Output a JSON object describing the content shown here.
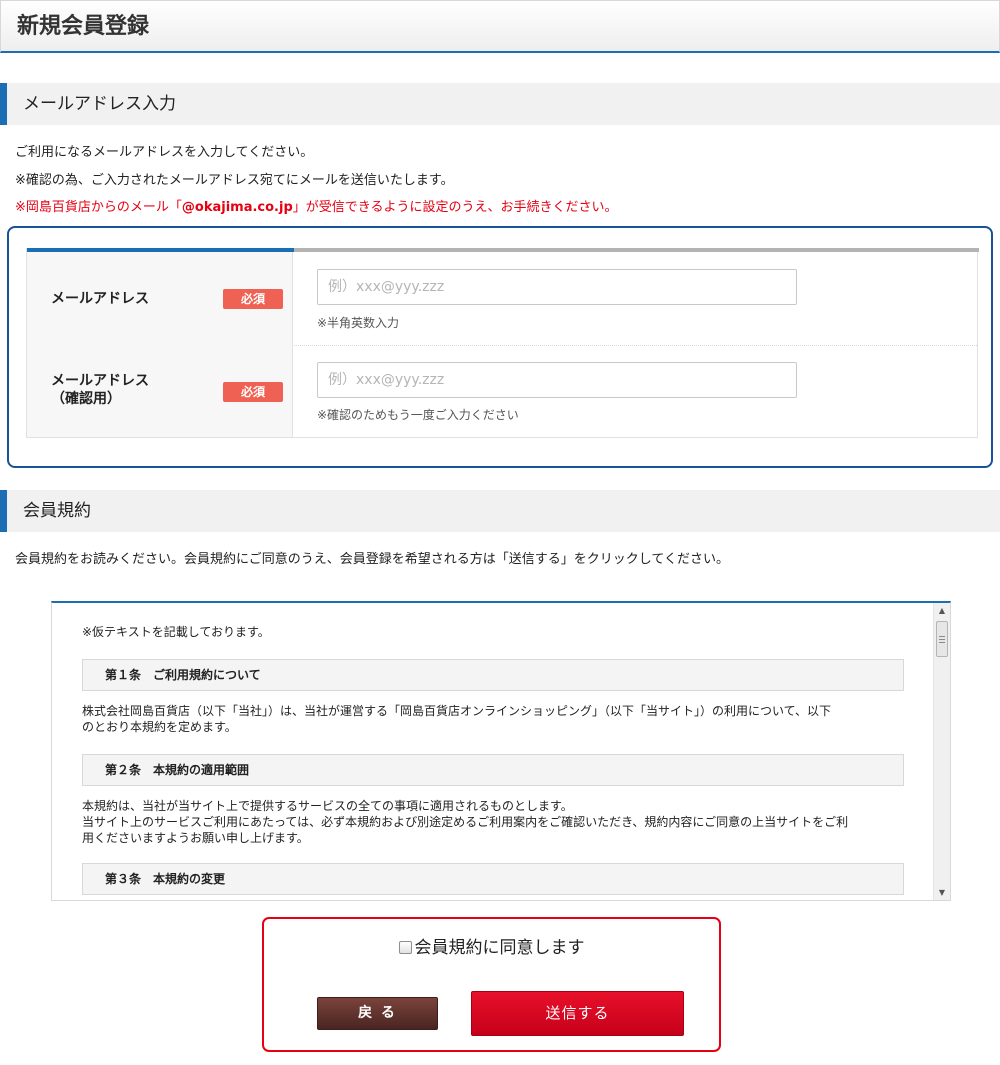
{
  "page": {
    "title": "新規会員登録"
  },
  "email_section": {
    "heading": "メールアドレス入力",
    "intro": "ご利用になるメールアドレスを入力してください。",
    "note": "※確認の為、ご入力されたメールアドレス宛てにメールを送信いたします。",
    "warning_prefix": "※岡島百貨店からのメール「",
    "warning_domain": "@okajima.co.jp",
    "warning_suffix": "」が受信できるように設定のうえ、お手続きください。",
    "fields": [
      {
        "label": "メールアドレス",
        "label_line2": "",
        "required": "必須",
        "placeholder": "例）xxx@yyy.zzz",
        "value": "",
        "hint": "※半角英数入力"
      },
      {
        "label": "メールアドレス",
        "label_line2": "（確認用）",
        "required": "必須",
        "placeholder": "例）xxx@yyy.zzz",
        "value": "",
        "hint": "※確認のためもう一度ご入力ください"
      }
    ]
  },
  "terms_section": {
    "heading": "会員規約",
    "intro": "会員規約をお読みください。会員規約にご同意のうえ、会員登録を希望される方は「送信する」をクリックしてください。",
    "note": "※仮テキストを記載しております。",
    "articles": [
      {
        "title": "第１条　ご利用規約について",
        "body_lines": [
          "株式会社岡島百貨店（以下「当社」）は、当社が運営する「岡島百貨店オンラインショッピング」（以下「当サイト」）の利用について、以下",
          "のとおり本規約を定めます。"
        ]
      },
      {
        "title": "第２条　本規約の適用範囲",
        "body_lines": [
          "本規約は、当社が当サイト上で提供するサービスの全ての事項に適用されるものとします。",
          "当サイト上のサービスご利用にあたっては、必ず本規約および別途定めるご利用案内をご確認いただき、規約内容にご同意の上当サイトをご利",
          "用くださいますようお願い申し上げます。"
        ]
      },
      {
        "title": "第３条　本規約の変更",
        "body_lines": []
      }
    ]
  },
  "agreement": {
    "checkbox_label": "会員規約に同意します",
    "checked": false,
    "back_label": "戻 る",
    "submit_label": "送信する"
  },
  "colors": {
    "accent_blue": "#1b6db4",
    "alert_red": "#e60012",
    "required_badge": "#ef6153",
    "back_button": "#5a2e29"
  }
}
